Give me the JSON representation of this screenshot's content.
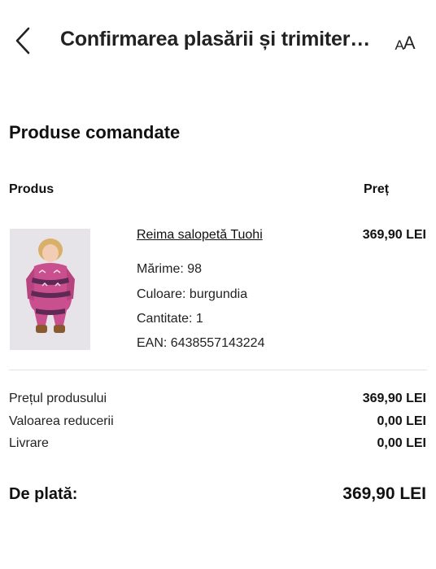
{
  "header": {
    "title": "Confirmarea plasării și trimitere...",
    "back_icon": "chevron-left-icon",
    "text_size_icon": "text-size-icon",
    "text_size_small": "A",
    "text_size_large": "A"
  },
  "section": {
    "title": "Produse comandate"
  },
  "table": {
    "col_product": "Produs",
    "col_price": "Preț"
  },
  "product": {
    "name": "Reima salopetă Tuohi",
    "price": "369,90 LEI",
    "size": "Mărime: 98",
    "color": "Culoare: burgundia",
    "quantity": "Cantitate: 1",
    "ean": "EAN: 6438557143224"
  },
  "summary": {
    "rows": [
      {
        "label": "Prețul produsului",
        "value": "369,90 LEI"
      },
      {
        "label": "Valoarea reducerii",
        "value": "0,00 LEI"
      },
      {
        "label": "Livrare",
        "value": "0,00 LEI"
      }
    ],
    "total_label": "De plată:",
    "total_value": "369,90 LEI"
  }
}
